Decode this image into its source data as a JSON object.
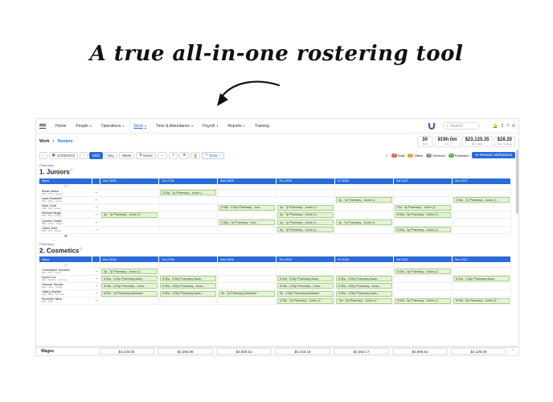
{
  "headline": "A true all-in-one rostering tool",
  "nav": {
    "items": [
      "Home",
      "People",
      "Operations",
      "Work",
      "Time & Attendance",
      "Payroll",
      "Reports",
      "Training"
    ],
    "search_placeholder": "Search",
    "notifications": "2"
  },
  "breadcrumb": {
    "root": "Work",
    "current": "Rosters"
  },
  "stats": [
    {
      "value": "30",
      "label": "Staff"
    },
    {
      "value": "819h 0m",
      "label": "Hrs"
    },
    {
      "value": "$23,125.35",
      "label": "Est. Wage"
    },
    {
      "value": "$28.20",
      "label": "Avg. hr wage"
    }
  ],
  "toolbar": {
    "date": "24/06/2022",
    "views": [
      "Shift",
      "Day",
      "Week"
    ],
    "sort": "Name",
    "tools": "Tools",
    "counts": [
      {
        "n": "4",
        "label": "Draft",
        "color": "#e0574a"
      },
      {
        "n": "1",
        "label": "Offers",
        "color": "#f0a02a"
      },
      {
        "n": "0",
        "label": "Declined",
        "color": "#888888"
      },
      {
        "n": "41",
        "label": "Published",
        "color": "#3aaa4a"
      }
    ],
    "publish": "Resend notifications"
  },
  "days": [
    "Mon 26/06",
    "Tue 27/06",
    "Wed 28/06",
    "Thu 29/06",
    "Fri 30/06",
    "Sat 01/07",
    "Sun 02/07"
  ],
  "juniors": {
    "dept": "Pharmacy",
    "title": "1. Juniors",
    "count": "6",
    "rows": [
      {
        "name": "Breah Atkins",
        "meta": "#013 · 20hrs · Casual",
        "shifts": [
          "",
          "3:30p - 7p Pharmacy - Junior (...",
          "",
          "",
          "",
          "",
          ""
        ]
      },
      {
        "name": "Isaac Bradwell",
        "meta": "#011 · 18hrs · Casual",
        "shifts": [
          "",
          "",
          "",
          "",
          "4p - 7p Pharmacy - Junior (J...",
          "",
          "3:30p - 7p Pharmacy - Junior (J..."
        ]
      },
      {
        "name": "Mark Cook",
        "meta": "#030 · 9hrs · Casual",
        "shifts": [
          "",
          "",
          "3:30p - 4:30p Pharmacy - Juni...",
          "4p - 7p Pharmacy - Junior (J...",
          "",
          "11a - 4p Pharmacy - Junior (J...",
          ""
        ]
      },
      {
        "name": "Micheal Mcgirr",
        "meta": "#029 · 8hrs · Casual",
        "shifts": [
          "4p - 7p Pharmacy - Junior (J...",
          "",
          "",
          "4p - 7p Pharmacy - Junior (J...",
          "",
          "8:30a - 3p Pharmacy - Junior (J...",
          ""
        ]
      },
      {
        "name": "Quentin Dwyer",
        "meta": "#048 · 8.5hrs · Casual",
        "shifts": [
          "",
          "",
          "3:30p - 7p Pharmacy - Juni...",
          "4p - 7p Pharmacy - Junior (J...",
          "4p - 7p Pharmacy - Junior (J...",
          "",
          ""
        ]
      },
      {
        "name": "Ulbert Tedd",
        "meta": "#022 · 4hrs · Casual",
        "shifts": [
          "",
          "",
          "",
          "4p - 7p Pharmacy - Junior (J...",
          "",
          "8:30a - 3p Pharmacy - Junior (J...",
          ""
        ]
      }
    ]
  },
  "cosmetics": {
    "dept": "Pharmacy",
    "title": "2. Cosmetics",
    "count": "9",
    "rows": [
      {
        "name": "Christopher Sanders",
        "meta": "#021 · 9hrs · Casual",
        "shifts": [
          "4p - 7p Pharmacy - Junior (J...",
          "",
          "",
          "",
          "",
          "8:30a - 3p Pharmacy - Junior (J...",
          ""
        ]
      },
      {
        "name": "David Cox",
        "meta": "#027 · 38.00hrs · Full Time",
        "shifts": [
          "8:30a - 3:30p Pharmacy Assis...",
          "8:30a - 3:30p Pharmacy Assis...",
          "",
          "8:30a - 3:30p Pharmacy Assis...",
          "8:30a - 3:30p Pharmacy Assis...",
          "",
          "8:30a - 1:30p Pharmacy Assis..."
        ]
      },
      {
        "name": "Hannah Temple",
        "meta": "#016 · 30hrs · Casual",
        "shifts": [
          "8:30a - 4:30p Pharmacy - Junio...",
          "8:30a - 4:30p Pharmacy - Junio...",
          "",
          "8:30a - 4:30p Pharmacy - Junio...",
          "8:30a - 4:30p Pharmacy - Junio...",
          "",
          ""
        ]
      },
      {
        "name": "Hillary Mueller",
        "meta": "#041 · 38hrs · Part Time",
        "shifts": [
          "8:30a - 7p Pharmacy Assistant",
          "8:30a - 3:30p Pharmacy Assis...",
          "9a - 7p Pharmacy Assistant",
          "9a - 4:30p Pharmacy Assistant",
          "8:30a - 4:30p Pharmacy Assis...",
          "",
          ""
        ]
      },
      {
        "name": "Rochelle Hilton",
        "meta": "#019 · 30hrs",
        "shifts": [
          "",
          "",
          "",
          "3:30p - 7p Pharmacy - Junior (J...",
          "11a - 5p Pharmacy - Junior (J...",
          "8:30a - 3p Pharmacy - Junior (J...",
          "8:30a - 3p Pharmacy - Junior (J..."
        ]
      }
    ]
  },
  "wages": {
    "label": "Wages",
    "values": [
      "$3,230.50",
      "$3,385.89",
      "$3,650.51",
      "$4,440.18",
      "$3,352.17",
      "$2,906.81",
      "$2,105.09"
    ]
  },
  "colors": {
    "accent": "#2a6bd6",
    "shift_bg": "#e5f3d6",
    "shift_border": "#a8cf85"
  }
}
